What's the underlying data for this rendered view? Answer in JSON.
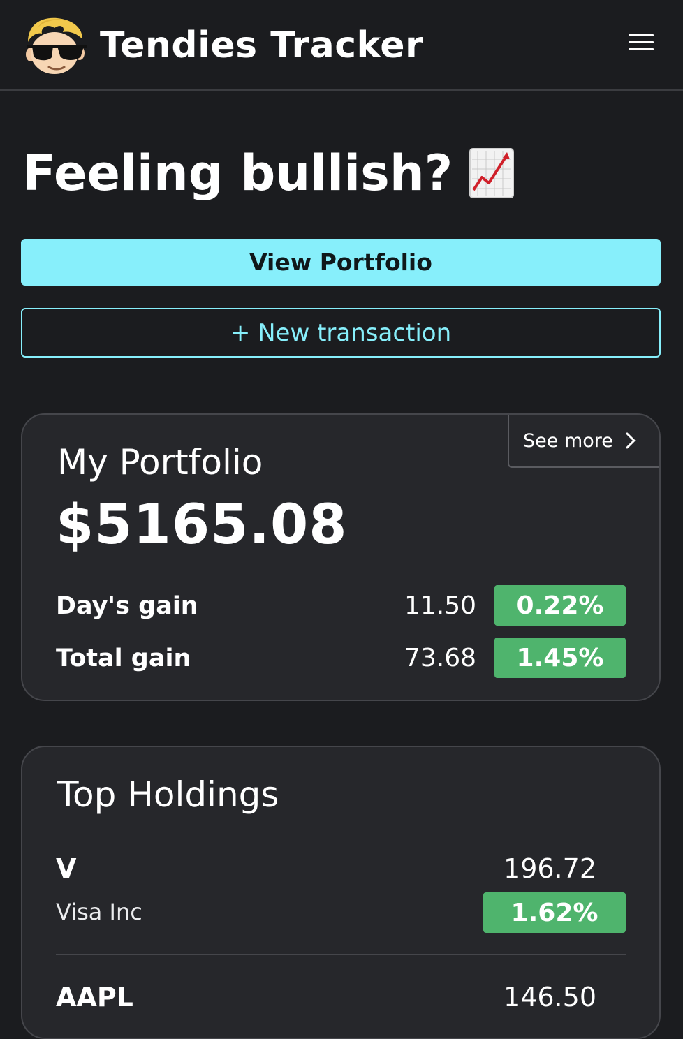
{
  "header": {
    "title": "Tendies Tracker",
    "logo_icon": "wsb-mascot-logo",
    "menu_icon": "hamburger-menu-icon"
  },
  "hero": {
    "text": "Feeling bullish?",
    "emoji_icon": "chart-increasing-icon"
  },
  "actions": {
    "view_portfolio_label": "View Portfolio",
    "new_transaction_label": "+ New transaction"
  },
  "portfolio": {
    "title": "My Portfolio",
    "see_more_label": "See more",
    "total": "$5165.08",
    "days_gain": {
      "label": "Day's gain",
      "value": "11.50",
      "percent": "0.22%"
    },
    "total_gain": {
      "label": "Total gain",
      "value": "73.68",
      "percent": "1.45%"
    }
  },
  "holdings": {
    "title": "Top Holdings",
    "items": [
      {
        "ticker": "V",
        "name": "Visa Inc",
        "price": "196.72",
        "percent": "1.62%"
      },
      {
        "ticker": "AAPL",
        "name": "",
        "price": "146.50",
        "percent": ""
      }
    ]
  },
  "colors": {
    "background": "#1b1c1f",
    "card": "#26272b",
    "accent": "#87effb",
    "positive": "#4fb46d"
  }
}
